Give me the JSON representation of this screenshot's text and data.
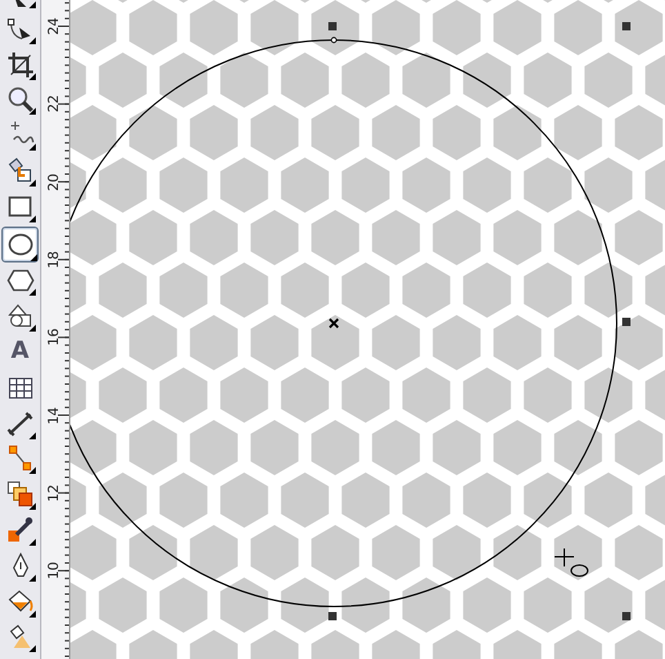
{
  "toolbox": {
    "tools": [
      {
        "kind": "pick",
        "flyout": true,
        "selected": false
      },
      {
        "kind": "shape",
        "flyout": true,
        "selected": false
      },
      {
        "kind": "crop",
        "flyout": true,
        "selected": false
      },
      {
        "kind": "zoom",
        "flyout": true,
        "selected": false
      },
      {
        "kind": "freehand",
        "flyout": true,
        "selected": false
      },
      {
        "kind": "smart-fill",
        "flyout": true,
        "selected": false
      },
      {
        "kind": "rectangle",
        "flyout": true,
        "selected": false
      },
      {
        "kind": "ellipse",
        "flyout": true,
        "selected": true
      },
      {
        "kind": "polygon",
        "flyout": true,
        "selected": false
      },
      {
        "kind": "basic-shapes",
        "flyout": true,
        "selected": false
      },
      {
        "kind": "text",
        "label": "A",
        "flyout": false,
        "selected": false
      },
      {
        "kind": "table",
        "flyout": false,
        "selected": false
      },
      {
        "kind": "dimension",
        "flyout": true,
        "selected": false
      },
      {
        "kind": "connector",
        "flyout": true,
        "selected": false
      },
      {
        "kind": "blend",
        "flyout": true,
        "selected": false
      },
      {
        "kind": "eyedropper",
        "flyout": true,
        "selected": false
      },
      {
        "kind": "outline",
        "flyout": true,
        "selected": false
      },
      {
        "kind": "fill",
        "flyout": true,
        "selected": false
      },
      {
        "kind": "interactive-fill",
        "flyout": true,
        "selected": false
      }
    ]
  },
  "ruler": {
    "labels": [
      "24",
      "22",
      "20",
      "18",
      "16",
      "14",
      "12",
      "10"
    ]
  },
  "canvas": {
    "selection": {
      "kind": "ellipse"
    }
  }
}
